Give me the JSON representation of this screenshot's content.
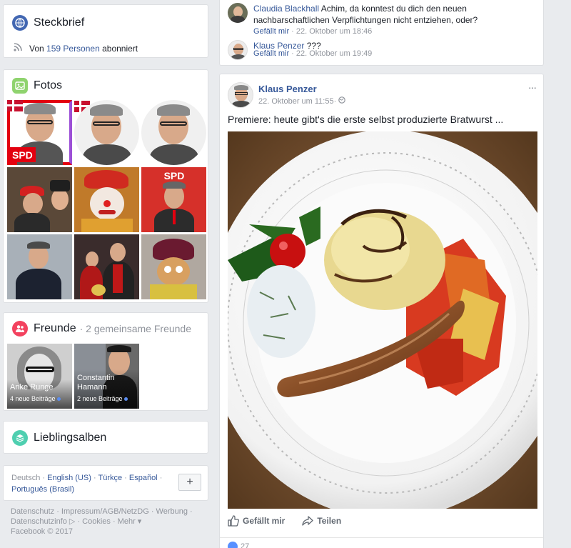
{
  "steckbrief": {
    "title": "Steckbrief",
    "subscribed_prefix": "Von ",
    "subscribed_count": "159 Personen",
    "subscribed_suffix": " abonniert"
  },
  "fotos": {
    "title": "Fotos",
    "spd_label": "SPD"
  },
  "freunde": {
    "title": "Freunde",
    "subtitle": "· 2 gemeinsame Freunde",
    "friends": [
      {
        "name": "Anke Runge",
        "posts": "4 neue Beiträge"
      },
      {
        "name": "Constantin Hamann",
        "posts": "2 neue Beiträge"
      }
    ]
  },
  "lieblingsalben": {
    "title": "Lieblingsalben"
  },
  "languages": {
    "current": "Deutsch",
    "options": [
      "English (US)",
      "Türkçe",
      "Español",
      "Português (Brasil)"
    ],
    "add_label": "+"
  },
  "footer": {
    "line1": "Datenschutz · Impressum/AGB/NetzDG · Werbung ·",
    "line2": "Datenschutzinfo ▷ · Cookies · Mehr ▾",
    "line3": "Facebook © 2017"
  },
  "comments": [
    {
      "author": "Claudia Blackhall",
      "text": "Achim, da konntest du dich den neuen nachbarschaftlichen Verpflichtungen nicht entziehen, oder?",
      "like": "Gefällt mir",
      "time": "22. Oktober um 18:46"
    },
    {
      "author": "Klaus Penzer",
      "text": "???",
      "like": "Gefällt mir",
      "time": "22. Oktober um 19:49"
    }
  ],
  "post": {
    "author": "Klaus Penzer",
    "time": "22. Oktober um 11:55",
    "text": "Premiere: heute gibt's die erste selbst produzierte Bratwurst ...",
    "more_label": "···",
    "like_label": "Gefällt mir",
    "share_label": "Teilen",
    "reactions_count": "27"
  },
  "colors": {
    "accent": "#365899",
    "meta": "#90949c",
    "spd_red": "#e3000f"
  }
}
